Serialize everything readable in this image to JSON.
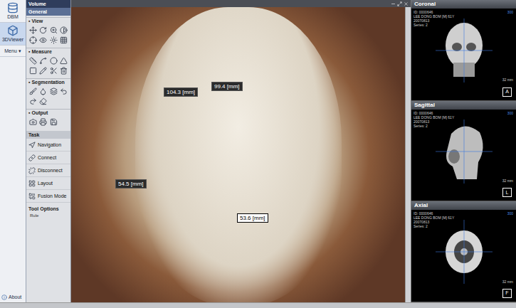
{
  "app_bar": {
    "items": [
      {
        "label": "DBM",
        "selected": false
      },
      {
        "label": "3DViewer",
        "selected": true
      },
      {
        "label": "Menu",
        "selected": false
      }
    ],
    "about": "About"
  },
  "panel": {
    "title": "Volume",
    "tab": "General",
    "sections": [
      {
        "title": "View"
      },
      {
        "title": "Measure"
      },
      {
        "title": "Segmentation"
      },
      {
        "title": "Output"
      }
    ],
    "task": {
      "title": "Task",
      "items": [
        {
          "label": "Navigation",
          "selected": false
        },
        {
          "label": "Connect",
          "selected": false
        },
        {
          "label": "Disconnect",
          "selected": false
        },
        {
          "label": "Layout",
          "selected": false
        },
        {
          "label": "Fusion Mode",
          "selected": false
        }
      ]
    },
    "options": {
      "title": "Tool Options",
      "label": "Rule"
    }
  },
  "viewer": {
    "measurements": [
      {
        "value": "104.3 [mm]",
        "selected": false
      },
      {
        "value": "99.4 [mm]",
        "selected": false
      },
      {
        "value": "54.5 [mm]",
        "selected": false
      },
      {
        "value": "53.6 [mm]",
        "selected": true
      }
    ]
  },
  "views": [
    {
      "title": "Coronal",
      "info": [
        "ID: 0000646",
        "LEE DONG BOM [M] 61Y",
        "20070813",
        "Series: 2"
      ],
      "window": "300",
      "scale": "32 mm",
      "orientation": "A"
    },
    {
      "title": "Sagittal",
      "info": [
        "ID: 0000646",
        "LEE DONG BOM [M] 61Y",
        "20070813",
        "Series: 2"
      ],
      "window": "300",
      "scale": "32 mm",
      "orientation": "L"
    },
    {
      "title": "Axial",
      "info": [
        "ID: 0000646",
        "LEE DONG BOM [M] 61Y",
        "20070813",
        "Series: 2"
      ],
      "window": "300",
      "scale": "32 mm",
      "orientation": "F"
    }
  ]
}
